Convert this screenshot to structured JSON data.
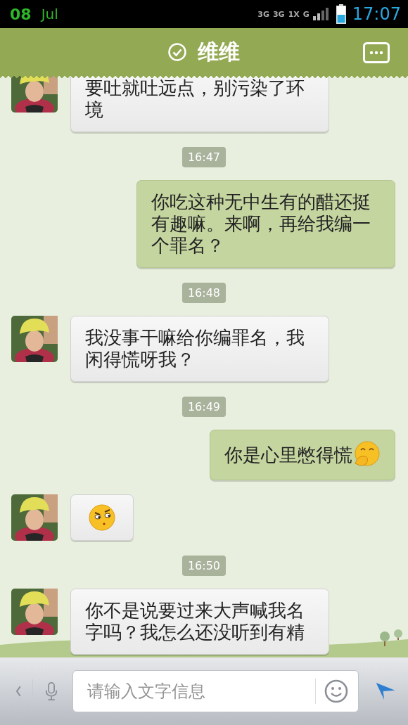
{
  "status_bar": {
    "date_day": "08",
    "date_month": "Jul",
    "network_labels": [
      "3G",
      "3G",
      "1X",
      "G"
    ],
    "time": "17:07"
  },
  "header": {
    "title": "维维",
    "verified": true
  },
  "messages": [
    {
      "kind": "received",
      "text": "要吐就吐远点，别污染了环境"
    },
    {
      "kind": "time",
      "text": "16:47"
    },
    {
      "kind": "sent",
      "text": "你吃这种无中生有的醋还挺有趣嘛。来啊，再给我编一个罪名？"
    },
    {
      "kind": "time",
      "text": "16:48"
    },
    {
      "kind": "received",
      "text": "我没事干嘛给你编罪名，我闲得慌呀我？"
    },
    {
      "kind": "time",
      "text": "16:49"
    },
    {
      "kind": "sent",
      "text": "你是心里憋得慌",
      "emoji": {
        "kind": "laughing"
      }
    },
    {
      "kind": "received",
      "emoji": {
        "kind": "smirking"
      }
    },
    {
      "kind": "time",
      "text": "16:50"
    },
    {
      "kind": "received",
      "text": "你不是说要过来大声喊我名字吗？我怎么还没听到有精"
    }
  ],
  "input": {
    "placeholder": "请输入文字信息"
  }
}
